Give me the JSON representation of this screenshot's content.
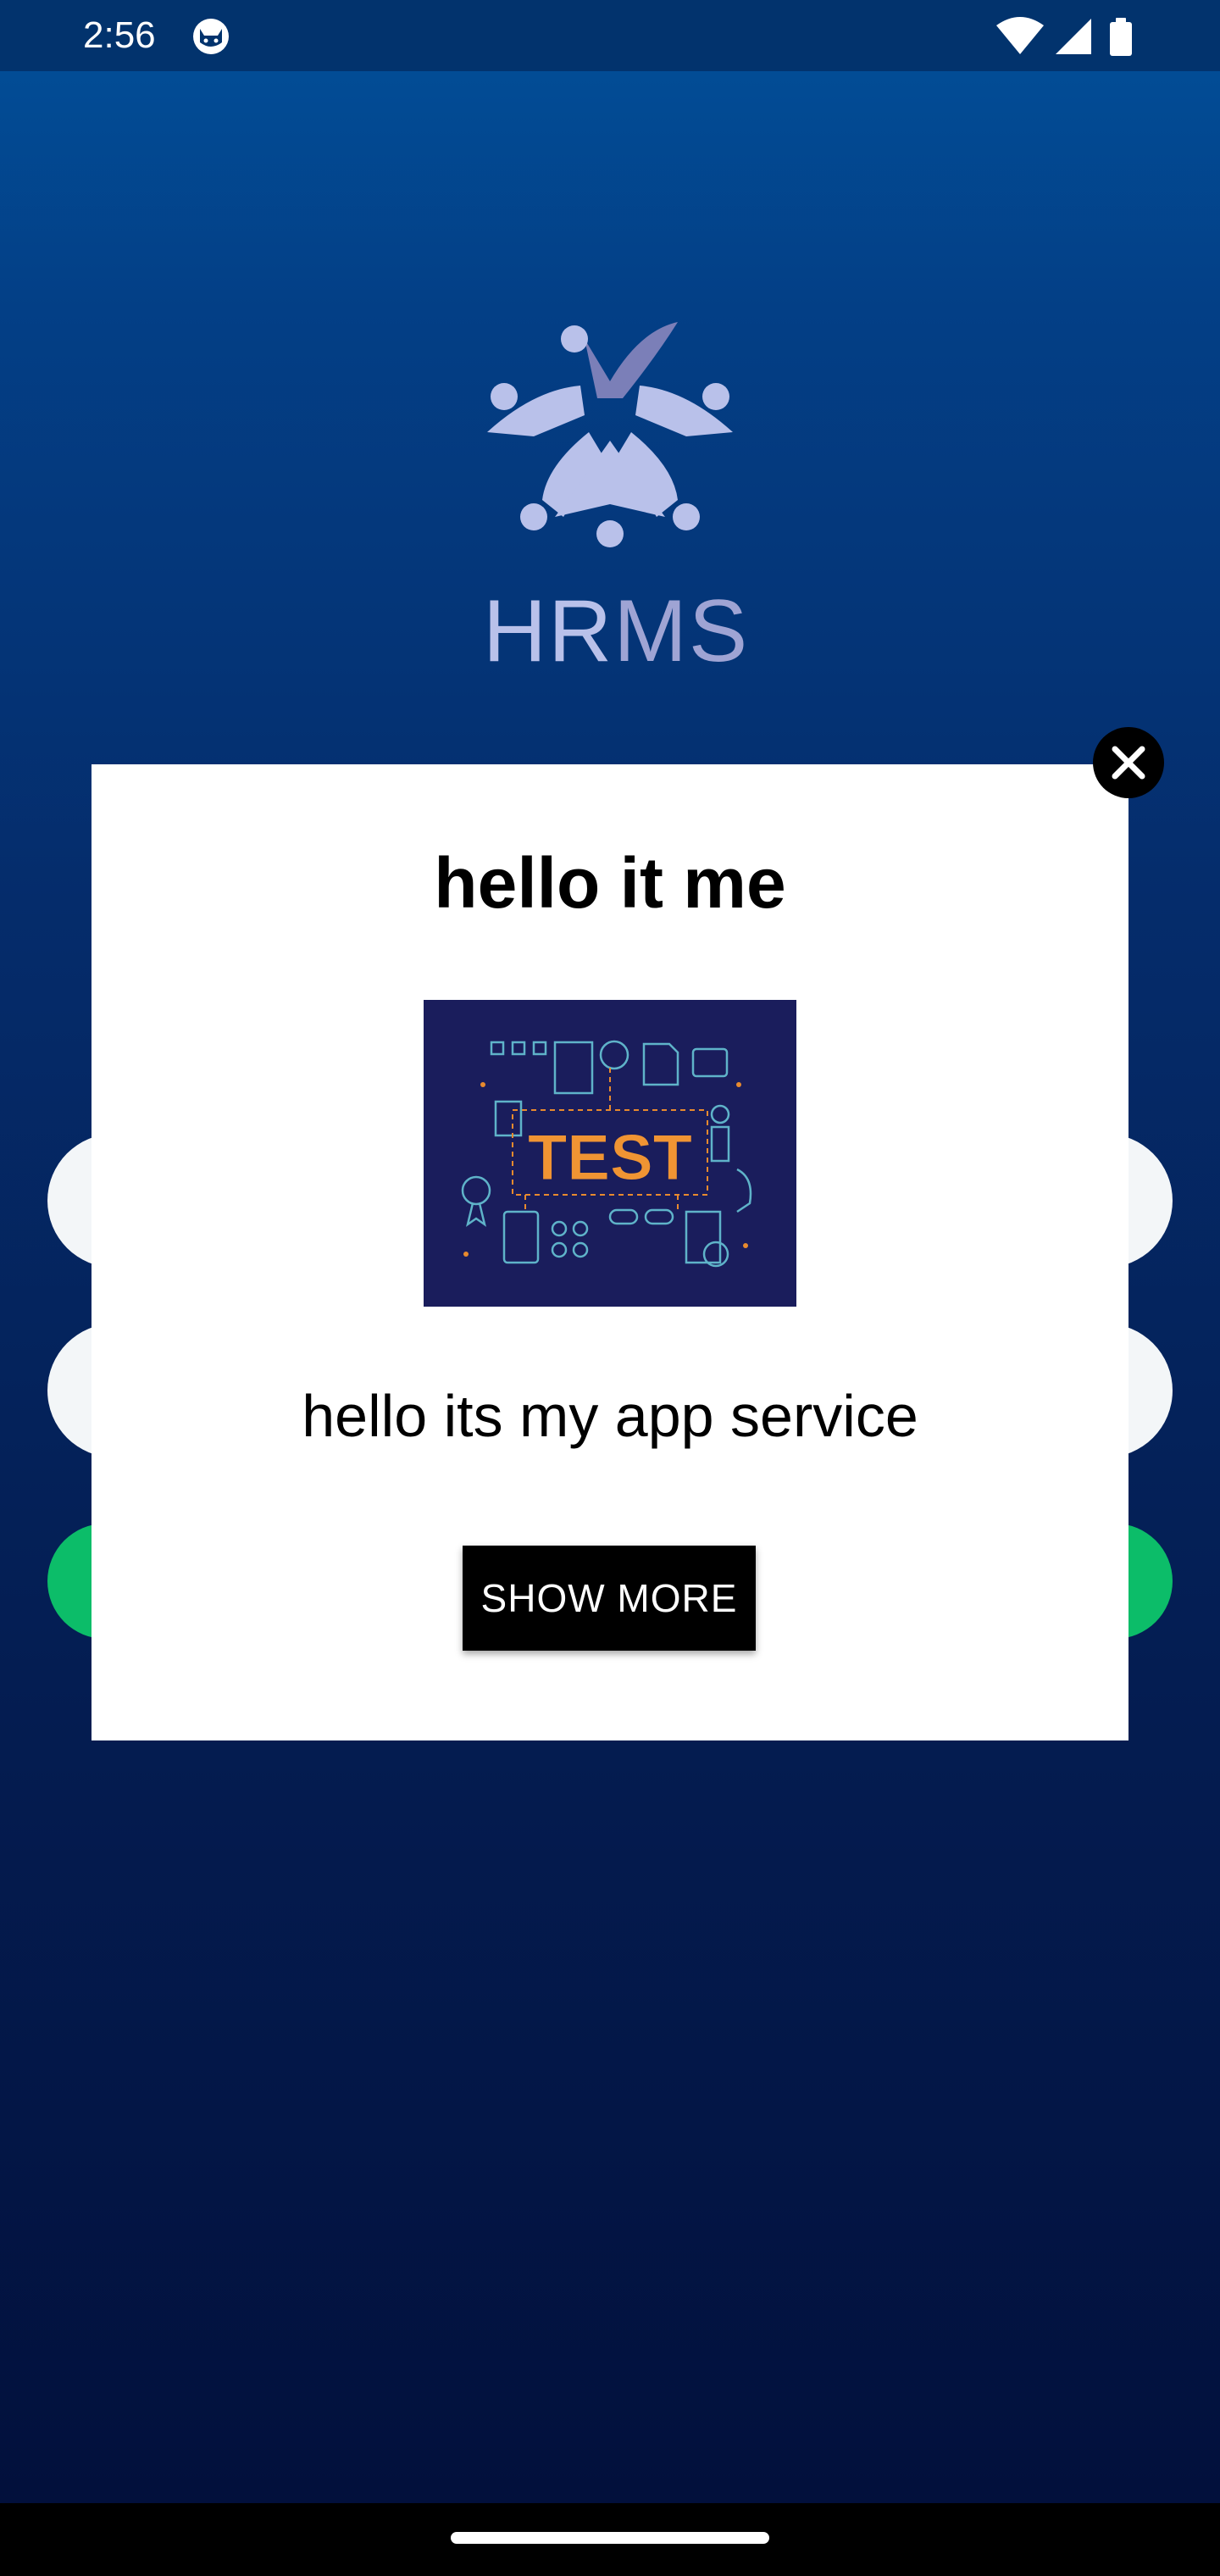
{
  "status_bar": {
    "time": "2:56",
    "icons": [
      "cat-notification-icon",
      "wifi-icon",
      "signal-icon",
      "battery-icon"
    ]
  },
  "app": {
    "logo_icon": "people-star-logo-icon",
    "logo_text_part1": "HR",
    "logo_text_part2": "MS",
    "colors": {
      "logo_light": "#b9c1ea",
      "logo_dark": "#9fa4d4",
      "logo_check": "#7b7fb8",
      "accent_green": "#0cbd69",
      "background_top": "#02509a",
      "background_bottom": "#020f3a"
    }
  },
  "modal": {
    "title": "hello it me",
    "image_text": "TEST",
    "image_icon": "test-illustration-icon",
    "body": "hello its my app service",
    "button_label": "SHOW MORE",
    "close_icon": "close-icon"
  },
  "nav_bar": {
    "home_indicator": "home-indicator"
  }
}
